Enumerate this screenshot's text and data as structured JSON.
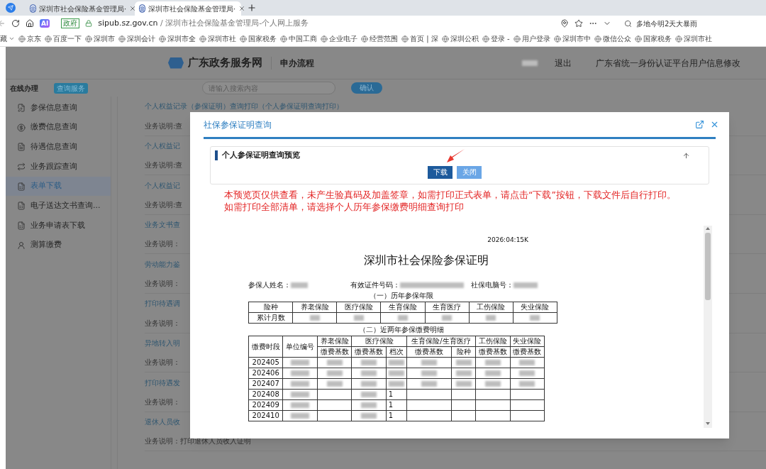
{
  "browser": {
    "tabs": [
      {
        "title": "深圳市社会保险基金管理局·",
        "selected": false
      },
      {
        "title": "深圳市社会保险基金管理局·",
        "selected": true
      }
    ],
    "ai_button": "AI",
    "address": {
      "badge": "政府",
      "host": "sipub.sz.gov.cn",
      "path": " / 深圳市社会保险基金管理局-个人网上服务"
    },
    "search": {
      "value": "多地今明2天大暴雨"
    },
    "bookmarks": [
      {
        "label": "藏",
        "menu": true
      },
      {
        "label": "京东",
        "menu": false
      },
      {
        "label": "百度一下",
        "menu": false
      },
      {
        "label": "深圳市",
        "menu": false
      },
      {
        "label": "深圳会计",
        "menu": false
      },
      {
        "label": "深圳市全",
        "menu": false
      },
      {
        "label": "深圳市社",
        "menu": false
      },
      {
        "label": "国家税务",
        "menu": false
      },
      {
        "label": "中国工商",
        "menu": false
      },
      {
        "label": "企业电子",
        "menu": false
      },
      {
        "label": "经营范围",
        "menu": false
      },
      {
        "label": "首页 | 深",
        "menu": false
      },
      {
        "label": "深圳公积",
        "menu": false
      },
      {
        "label": "登录 -",
        "menu": false
      },
      {
        "label": "用户登录",
        "menu": false
      },
      {
        "label": "深圳市中",
        "menu": false
      },
      {
        "label": "微信公众",
        "menu": false
      },
      {
        "label": "国家税务",
        "menu": false
      },
      {
        "label": "深圳市社",
        "menu": false
      }
    ]
  },
  "site_header": {
    "logo": "广东政务服务网",
    "section": "申办流程",
    "links": [
      "退出",
      "广东省统一身份认证平台用户信息修改"
    ]
  },
  "toolbar": {
    "label": "在线办理",
    "tab": "查询服务",
    "search_placeholder": "请输入搜索内容",
    "confirm": "确认"
  },
  "sidebar": {
    "items": [
      {
        "label": "参保信息查询",
        "selected": false
      },
      {
        "label": "缴费信息查询",
        "selected": false
      },
      {
        "label": "待遇信息查询",
        "selected": false
      },
      {
        "label": "业务跟踪查询",
        "selected": false
      },
      {
        "label": "表单下载",
        "selected": true
      },
      {
        "label": "电子送达文书查询...",
        "selected": false
      },
      {
        "label": "业务申请表下载",
        "selected": false
      },
      {
        "label": "测算缴费",
        "selected": false
      }
    ]
  },
  "services": [
    {
      "title": "个人权益记录（参保证明）查询打印（个人参保证明查询打印）",
      "desc": "业务说明:查"
    },
    {
      "title": "个人权益记",
      "desc": "业务说明:查"
    },
    {
      "title": "个人权益记",
      "desc": "业务说明:查"
    },
    {
      "title": "业务文书查",
      "desc": "业务说明："
    },
    {
      "title": "劳动能力鉴",
      "desc": "业务说明："
    },
    {
      "title": "打印待遇调",
      "desc": "业务说明："
    },
    {
      "title": "异地转入明",
      "desc": "业务说明："
    },
    {
      "title": "打印待遇发",
      "desc": "业务说明："
    },
    {
      "title": "退休人员收",
      "desc": "业务说明：打印退休人员收入证明"
    }
  ],
  "dialog": {
    "title": "社保参保证明查询",
    "panel_title": "个人参保证明查询预览",
    "buttons": [
      {
        "label": "下载",
        "kind": "primary"
      },
      {
        "label": "关闭",
        "kind": "secondary"
      }
    ],
    "notice": [
      "本预览页仅供查看，未产生验真码及加盖签章，如需打印正式表单，请点击“下载”按钮，下载文件后自行打印。",
      "如需打印全部清单，请选择个人历年参保缴费明细查询打印"
    ],
    "document": {
      "timestamp": "2026:04:15K",
      "title": "深圳市社会保险参保证明",
      "fields": [
        "参保人姓名：",
        "有效证件号码：",
        "社保电脑号："
      ],
      "section_1": "（一）历年参保年限",
      "years_table": {
        "header": [
          "险种",
          "养老保险",
          "医疗保险",
          "生育保险",
          "生育医疗",
          "工伤保险",
          "失业保险"
        ],
        "row_label": "累计月数"
      },
      "section_2": "（二）近两年参保缴费明细",
      "detail_table": {
        "groups": [
          {
            "label": "缴费时段"
          },
          {
            "label": "单位编号"
          },
          {
            "label": "养老保险",
            "columns": [
              "缴费基数"
            ]
          },
          {
            "label": "医疗保险",
            "columns": [
              "缴费基数",
              "档次"
            ]
          },
          {
            "label": "生育保险/生育医疗",
            "columns": [
              "缴费基数",
              "险种"
            ]
          },
          {
            "label": "工伤保险",
            "columns": [
              "缴费基数"
            ]
          },
          {
            "label": "失业保险",
            "columns": [
              "缴费基数"
            ]
          }
        ],
        "rows": [
          {
            "period": "202405",
            "redacted": true
          },
          {
            "period": "202406",
            "redacted": true
          },
          {
            "period": "202407",
            "redacted": true
          },
          {
            "period": "202408",
            "redacted": false,
            "grade": "1"
          },
          {
            "period": "202409",
            "redacted": false,
            "grade": "1"
          },
          {
            "period": "202410",
            "redacted": false,
            "grade": "1"
          }
        ]
      }
    }
  }
}
